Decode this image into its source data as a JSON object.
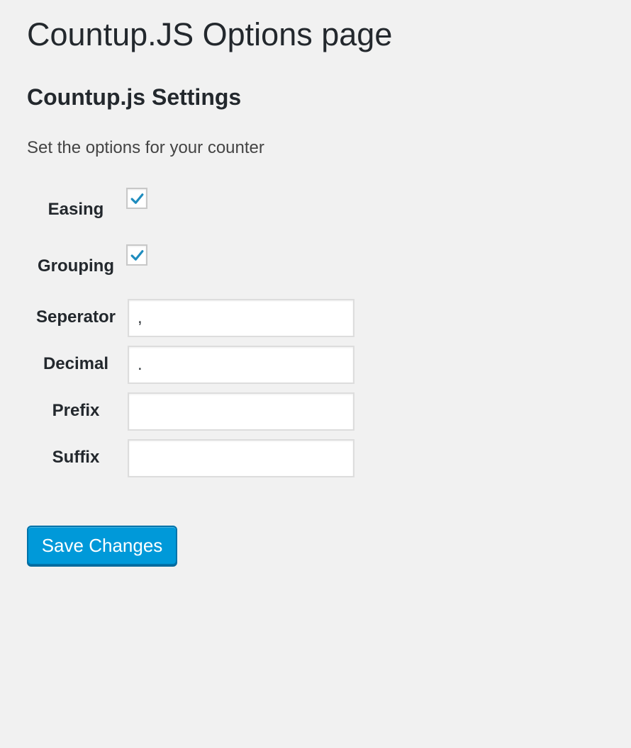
{
  "page": {
    "title": "Countup.JS Options page"
  },
  "section": {
    "title": "Countup.js Settings",
    "description": "Set the options for your counter"
  },
  "fields": {
    "easing": {
      "label": "Easing",
      "checked": true
    },
    "grouping": {
      "label": "Grouping",
      "checked": true
    },
    "separator": {
      "label": "Seperator",
      "value": ","
    },
    "decimal": {
      "label": "Decimal",
      "value": "."
    },
    "prefix": {
      "label": "Prefix",
      "value": ""
    },
    "suffix": {
      "label": "Suffix",
      "value": ""
    }
  },
  "actions": {
    "save_label": "Save Changes"
  },
  "colors": {
    "background": "#f1f1f1",
    "primary_button": "#0099d9",
    "primary_button_border": "#0073aa",
    "checkmark": "#1e8cbe"
  },
  "icons": {
    "checkbox_mark": "checkmark-icon"
  }
}
